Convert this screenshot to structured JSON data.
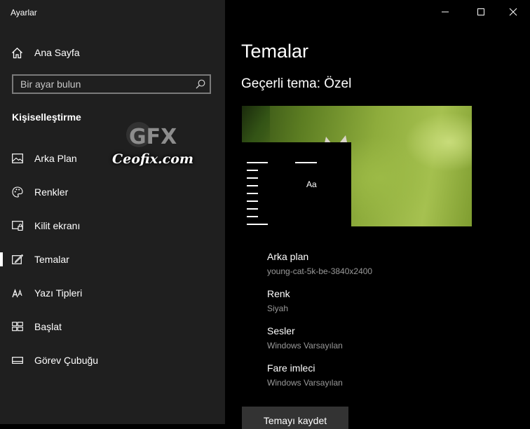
{
  "window": {
    "title": "Ayarlar"
  },
  "sidebar": {
    "home_label": "Ana Sayfa",
    "search_placeholder": "Bir ayar bulun",
    "section_title": "Kişiselleştirme",
    "items": [
      {
        "label": "Arka Plan",
        "icon": "picture-icon"
      },
      {
        "label": "Renkler",
        "icon": "palette-icon"
      },
      {
        "label": "Kilit ekranı",
        "icon": "lock-screen-icon"
      },
      {
        "label": "Temalar",
        "icon": "themes-icon",
        "active": true
      },
      {
        "label": "Yazı Tipleri",
        "icon": "fonts-icon"
      },
      {
        "label": "Başlat",
        "icon": "start-icon"
      },
      {
        "label": "Görev Çubuğu",
        "icon": "taskbar-icon"
      }
    ]
  },
  "watermark": {
    "brand": "GFX",
    "text": "Ceofix.com"
  },
  "main": {
    "title": "Temalar",
    "current_theme": "Geçerli tema: Özel",
    "preview": {
      "sample_text": "Aa"
    },
    "properties": [
      {
        "name": "Arka plan",
        "value": "young-cat-5k-be-3840x2400"
      },
      {
        "name": "Renk",
        "value": "Siyah"
      },
      {
        "name": "Sesler",
        "value": "Windows Varsayılan"
      },
      {
        "name": "Fare imleci",
        "value": "Windows Varsayılan"
      }
    ],
    "save_button": "Temayı kaydet"
  },
  "colors": {
    "sidebar_bg": "#1f1f1f",
    "main_bg": "#000000",
    "secondary_text": "#999999",
    "button_bg": "#333333"
  }
}
